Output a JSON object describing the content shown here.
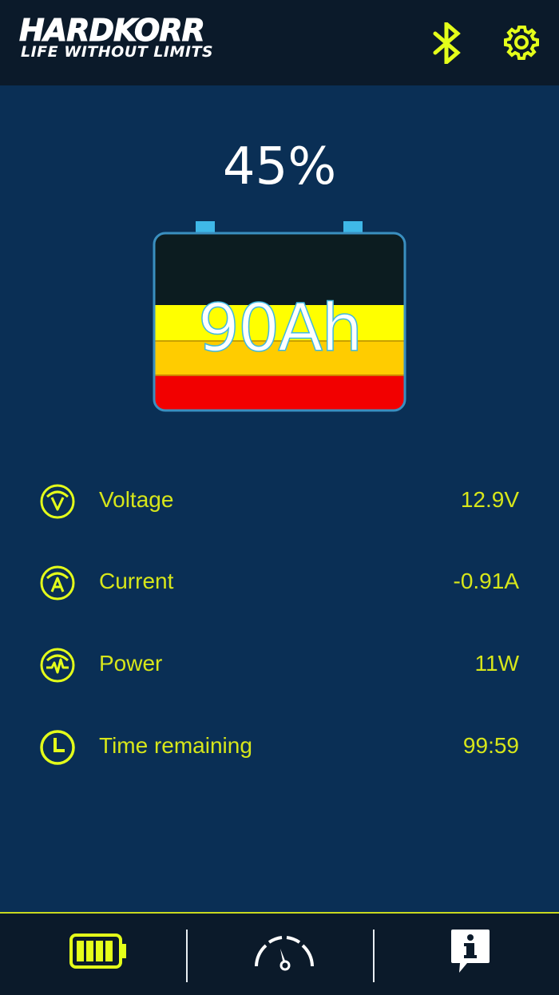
{
  "header": {
    "brand": "HARDKORR",
    "tagline": "LIFE WITHOUT LIMITS",
    "bluetooth_icon": "bluetooth-icon",
    "settings_icon": "gear-icon"
  },
  "battery": {
    "state_of_charge": "45%",
    "capacity": "90Ah",
    "charge_fraction": 0.45,
    "colors": {
      "empty": "#0c1c20",
      "level_high": "#ffff00",
      "level_mid": "#ffcc00",
      "level_low": "#f20000",
      "terminal": "#3fb8e8",
      "outline": "#3a8fc0"
    }
  },
  "metrics": [
    {
      "label": "Voltage",
      "value": "12.9V",
      "icon": "voltage-icon"
    },
    {
      "label": "Current",
      "value": "-0.91A",
      "icon": "current-icon"
    },
    {
      "label": "Power",
      "value": "11W",
      "icon": "power-icon"
    },
    {
      "label": "Time remaining",
      "value": "99:59",
      "icon": "clock-icon"
    }
  ],
  "tabs": [
    {
      "name": "battery-tab",
      "icon": "battery-icon",
      "active": true
    },
    {
      "name": "gauge-tab",
      "icon": "gauge-icon",
      "active": false
    },
    {
      "name": "info-tab",
      "icon": "info-icon",
      "active": false
    }
  ],
  "colors": {
    "background": "#0a2f55",
    "bar": "#0b1a2a",
    "accent": "#d7e61a",
    "icon_accent": "#e4ff1a"
  }
}
